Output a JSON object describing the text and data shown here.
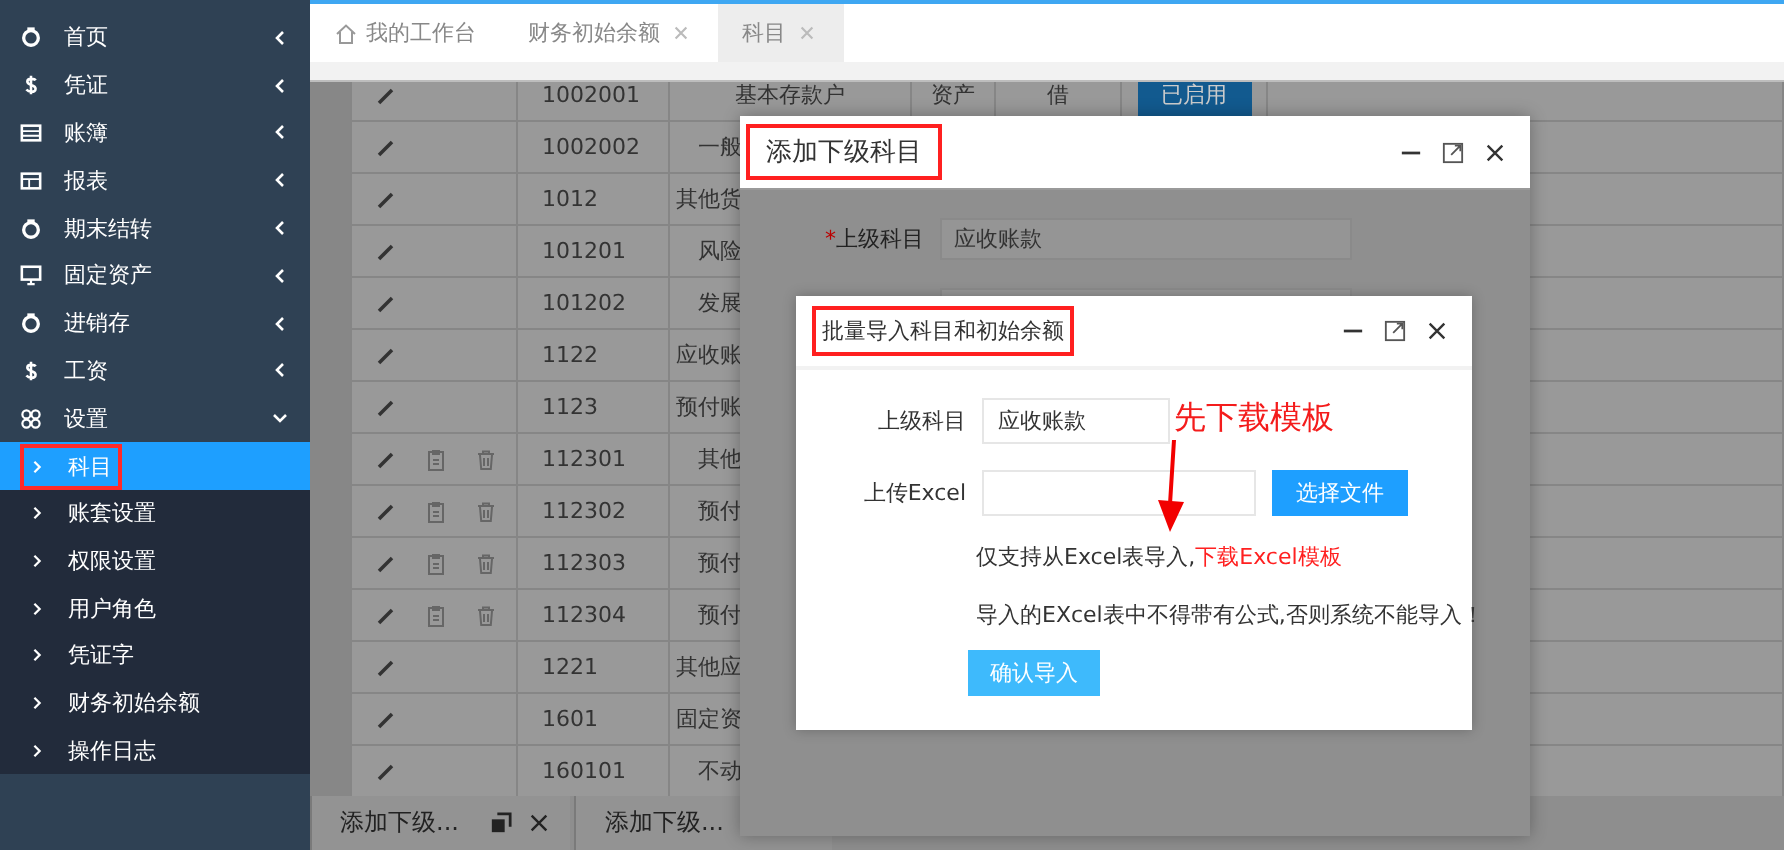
{
  "sidebar": {
    "items": [
      {
        "label": "首页",
        "expanded": false
      },
      {
        "label": "凭证",
        "expanded": false
      },
      {
        "label": "账簿",
        "expanded": false
      },
      {
        "label": "报表",
        "expanded": false
      },
      {
        "label": "期末结转",
        "expanded": false
      },
      {
        "label": "固定资产",
        "expanded": false
      },
      {
        "label": "进销存",
        "expanded": false
      },
      {
        "label": "工资",
        "expanded": false
      },
      {
        "label": "设置",
        "expanded": true,
        "children": [
          {
            "label": "科目",
            "selected": true,
            "highlighted": true
          },
          {
            "label": "账套设置",
            "selected": false,
            "highlighted": false
          },
          {
            "label": "权限设置",
            "selected": false,
            "highlighted": false
          },
          {
            "label": "用户角色",
            "selected": false,
            "highlighted": false
          },
          {
            "label": "凭证字",
            "selected": false,
            "highlighted": false
          },
          {
            "label": "财务初始余额",
            "selected": false,
            "highlighted": false
          },
          {
            "label": "操作日志",
            "selected": false,
            "highlighted": false
          }
        ]
      }
    ]
  },
  "tabs": [
    {
      "kind": "home",
      "label": "我的工作台",
      "selected": false
    },
    {
      "kind": "closable",
      "label": "财务初始余额",
      "selected": false
    },
    {
      "kind": "closable",
      "label": "科目",
      "selected": true
    }
  ],
  "table": {
    "rows": [
      {
        "kind": "group",
        "code": "1002001",
        "name": "基本存款户",
        "type": "资产",
        "direction": "借",
        "status": "已启用"
      },
      {
        "kind": "group",
        "code": "1002002",
        "name": "一般"
      },
      {
        "kind": "group",
        "code": "1012",
        "name": "其他货"
      },
      {
        "kind": "group",
        "code": "101201",
        "name": "风险"
      },
      {
        "kind": "group",
        "code": "101202",
        "name": "发展"
      },
      {
        "kind": "group",
        "code": "1122",
        "name": "应收账"
      },
      {
        "kind": "group",
        "code": "1123",
        "name": "预付账"
      },
      {
        "kind": "leaf",
        "code": "112301",
        "name": "其他"
      },
      {
        "kind": "leaf",
        "code": "112302",
        "name": "预付"
      },
      {
        "kind": "leaf",
        "code": "112303",
        "name": "预付"
      },
      {
        "kind": "leaf",
        "code": "112304",
        "name": "预付"
      },
      {
        "kind": "group",
        "code": "1221",
        "name": "其他应"
      },
      {
        "kind": "group",
        "code": "1601",
        "name": "固定资"
      },
      {
        "kind": "group",
        "code": "160101",
        "name": "不动"
      }
    ]
  },
  "minimized": [
    {
      "title": "添加下级...",
      "controls": true
    },
    {
      "title": "添加下级...",
      "controls": false
    }
  ],
  "dialog": {
    "title": "添加下级科目",
    "highlighted": true,
    "field": {
      "required_mark": "*",
      "label": "上级科目",
      "value": "应收账款"
    }
  },
  "import_dialog": {
    "title": "批量导入科目和初始余额",
    "highlighted": true,
    "fields": [
      {
        "kind": "text",
        "label": "上级科目",
        "value": "应收账款"
      },
      {
        "kind": "file",
        "label": "上传Excel",
        "button": "选择文件"
      }
    ],
    "note": {
      "text": "仅支持从Excel表导入,",
      "link": "下载Excel模板"
    },
    "warning": "导入的EXcel表中不得带有公式,否则系统不能导入！",
    "submit": "确认导入"
  },
  "annotation": {
    "text": "先下载模板"
  }
}
